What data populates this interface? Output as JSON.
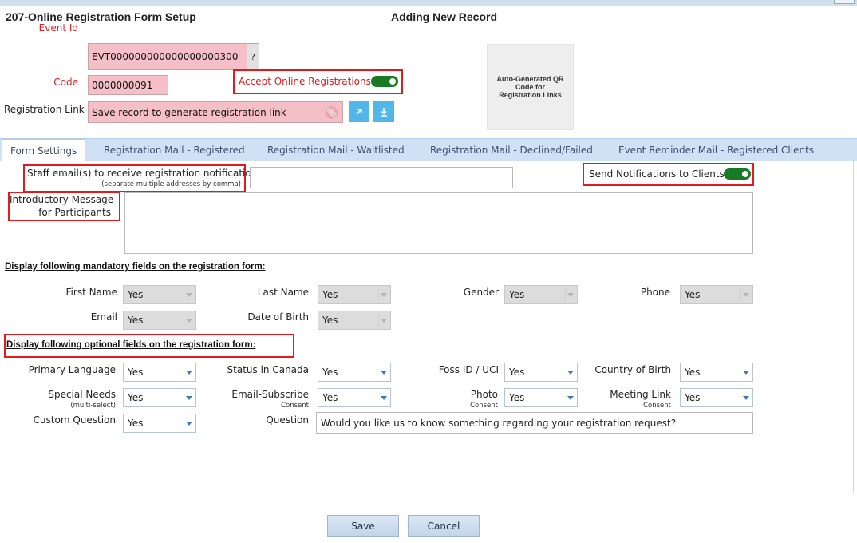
{
  "header": {
    "title": "207-Online Registration Form Setup",
    "mode": "Adding New Record"
  },
  "record": {
    "event_id_label": "Event Id",
    "event_id_value": "EVT000000000000000000300",
    "lookup_label": "?",
    "code_label": "Code",
    "code_value": "0000000091",
    "accept_label": "Accept Online Registrations",
    "accept_on": true,
    "link_label": "Registration Link",
    "link_value": "Save record to generate registration link",
    "qr_text": "Auto-Generated QR Code for Registration Links"
  },
  "tabs": [
    {
      "label": "Form Settings",
      "active": true
    },
    {
      "label": "Registration Mail - Registered",
      "active": false
    },
    {
      "label": "Registration Mail - Waitlisted",
      "active": false
    },
    {
      "label": "Registration Mail - Declined/Failed",
      "active": false
    },
    {
      "label": "Event Reminder Mail - Registered Clients",
      "active": false
    }
  ],
  "form": {
    "staff_email_label": "Staff email(s) to receive registration notifications",
    "staff_email_hint": "(separate multiple addresses by comma)",
    "staff_email_value": "",
    "send_notif_label": "Send Notifications to Clients",
    "send_notif_on": true,
    "intro_label_1": "Introductory Message",
    "intro_label_2": "for Participants",
    "intro_value": ""
  },
  "mandatory": {
    "heading": "Display following mandatory fields on the registration form:",
    "fields": [
      {
        "label": "First Name",
        "value": "Yes"
      },
      {
        "label": "Last Name",
        "value": "Yes"
      },
      {
        "label": "Gender",
        "value": "Yes"
      },
      {
        "label": "Phone",
        "value": "Yes"
      },
      {
        "label": "Email",
        "value": "Yes"
      },
      {
        "label": "Date of Birth",
        "value": "Yes"
      }
    ]
  },
  "optional": {
    "heading": "Display following optional fields on the registration form:",
    "fields": [
      {
        "label": "Primary Language",
        "sub": "",
        "value": "Yes"
      },
      {
        "label": "Status in Canada",
        "sub": "",
        "value": "Yes"
      },
      {
        "label": "Foss ID / UCI",
        "sub": "",
        "value": "Yes"
      },
      {
        "label": "Country of Birth",
        "sub": "",
        "value": "Yes"
      },
      {
        "label": "Special Needs",
        "sub": "(multi-select)",
        "value": "Yes"
      },
      {
        "label": "Email-Subscribe",
        "sub": "Consent",
        "value": "Yes"
      },
      {
        "label": "Photo",
        "sub": "Consent",
        "value": "Yes"
      },
      {
        "label": "Meeting Link",
        "sub": "Consent",
        "value": "Yes"
      },
      {
        "label": "Custom Question",
        "sub": "",
        "value": "Yes"
      }
    ],
    "question_label": "Question",
    "question_value": "Would you like us to know something regarding your registration request?"
  },
  "actions": {
    "save": "Save",
    "cancel": "Cancel"
  }
}
